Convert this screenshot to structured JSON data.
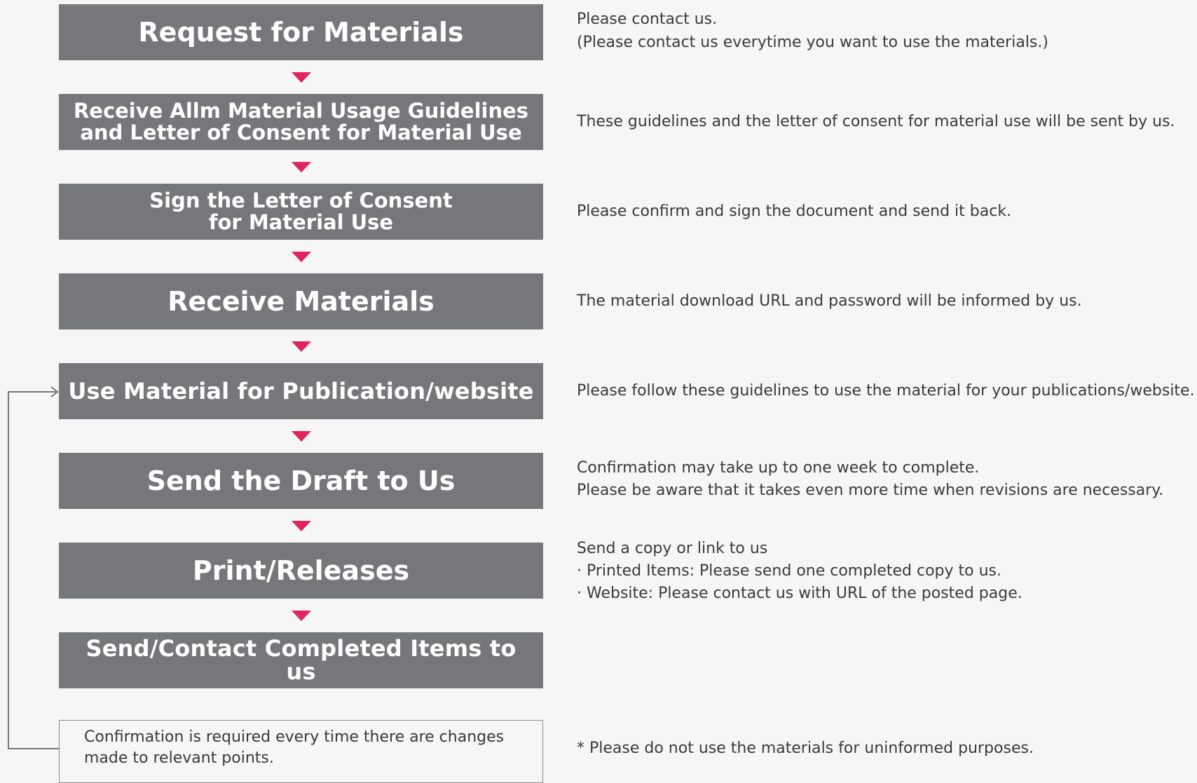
{
  "steps": [
    {
      "title_lines": [
        "Request for Materials"
      ]
    },
    {
      "title_lines": [
        "Receive Allm Material Usage Guidelines",
        "and Letter of Consent for Material Use"
      ]
    },
    {
      "title_lines": [
        "Sign the Letter of Consent",
        "for Material Use"
      ]
    },
    {
      "title_lines": [
        "Receive Materials"
      ]
    },
    {
      "title_lines": [
        "Use Material for Publication/website"
      ]
    },
    {
      "title_lines": [
        "Send the Draft to Us"
      ]
    },
    {
      "title_lines": [
        "Print/Releases"
      ]
    },
    {
      "title_lines": [
        "Send/Contact Completed Items to us"
      ]
    }
  ],
  "descriptions": [
    {
      "lines": [
        "Please contact us.",
        "(Please contact us everytime you want to use the materials.)"
      ]
    },
    {
      "lines": [
        "These guidelines and the letter of consent for material use will be sent by us."
      ]
    },
    {
      "lines": [
        "Please confirm and sign the document and send it back."
      ]
    },
    {
      "lines": [
        "The material download URL and password will be informed by us."
      ]
    },
    {
      "lines": [
        "Please follow these guidelines to use the material for your publications/website."
      ]
    },
    {
      "lines": [
        "Confirmation may take up to one week to complete.",
        "Please be aware that it takes even more time when revisions are necessary."
      ]
    },
    {
      "lines": [
        "Send a copy or link to us",
        "· Printed Items: Please send one completed copy to us.",
        "· Website: Please contact us with URL of the posted page."
      ]
    }
  ],
  "note": {
    "lines": [
      "Confirmation is required every time there are changes",
      "made to relevant points."
    ]
  },
  "footnote": "* Please do not use the materials for uninformed purposes.",
  "colors": {
    "background": "#f6f6f6",
    "step_box": "#76777b",
    "step_text": "#ffffff",
    "arrow": "#e0245e",
    "body_text": "#3a3a3a",
    "loop_line": "#76777b"
  }
}
